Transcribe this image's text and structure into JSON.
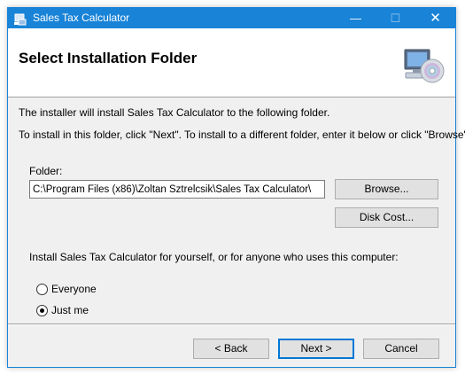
{
  "window": {
    "title": "Sales Tax Calculator"
  },
  "titlebar": {
    "minimize": "—",
    "maximize": "☐",
    "close": "✕"
  },
  "header": {
    "title": "Select Installation Folder",
    "icon": "setup-disc-computer-icon"
  },
  "body": {
    "line1": "The installer will install Sales Tax Calculator  to the following folder.",
    "line2": "To install in this folder, click \"Next\". To install to a different folder, enter it below or click \"Browse\"."
  },
  "folder": {
    "label": "Folder:",
    "value": "C:\\Program Files (x86)\\Zoltan Sztrelcsik\\Sales Tax Calculator\\"
  },
  "buttons": {
    "browse": "Browse...",
    "disk_cost": "Disk Cost...",
    "back": "< Back",
    "next": "Next >",
    "cancel": "Cancel"
  },
  "install_for": {
    "prompt": "Install Sales Tax Calculator  for yourself, or for anyone who uses this computer:",
    "options": [
      {
        "label": "Everyone",
        "selected": false
      },
      {
        "label": "Just me",
        "selected": true
      }
    ]
  },
  "colors": {
    "titlebar": "#1883d7",
    "accent": "#0078d7"
  }
}
